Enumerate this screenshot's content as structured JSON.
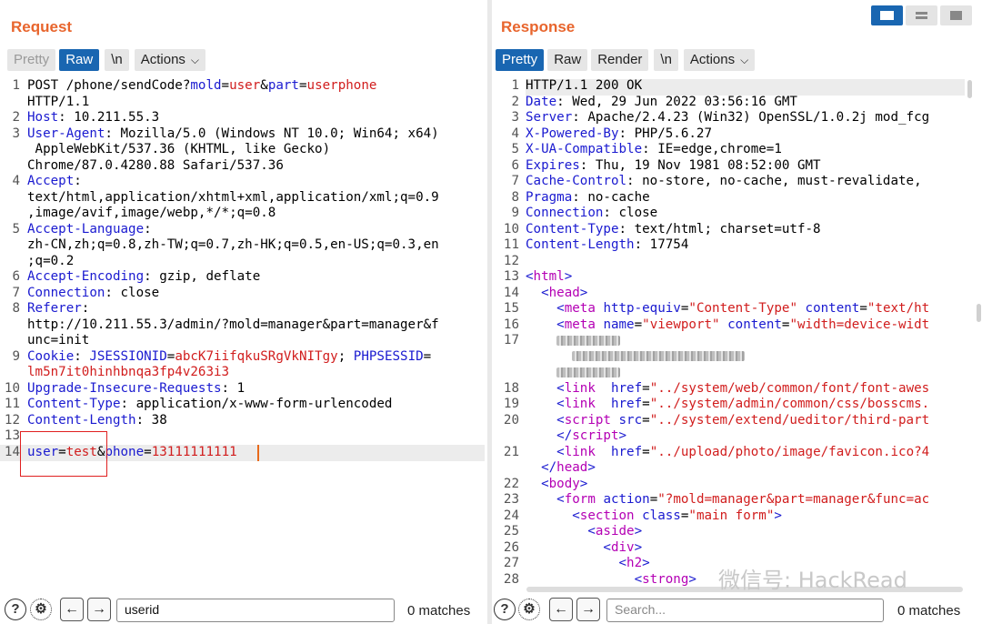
{
  "request": {
    "title": "Request",
    "tabs": [
      "Pretty",
      "Raw",
      "\\n",
      "Actions"
    ],
    "lines": [
      {
        "n": "1",
        "segs": [
          [
            "POST /phone/sendCode?",
            ""
          ],
          [
            "mold",
            "k"
          ],
          [
            "=",
            ""
          ],
          [
            "user",
            "v"
          ],
          [
            "&",
            ""
          ],
          [
            "part",
            "k"
          ],
          [
            "=",
            ""
          ],
          [
            "userphone",
            "v"
          ]
        ]
      },
      {
        "n": "",
        "segs": [
          [
            "HTTP/1.1",
            ""
          ]
        ]
      },
      {
        "n": "2",
        "segs": [
          [
            "Host",
            "k"
          ],
          [
            ": 10.211.55.3",
            ""
          ]
        ]
      },
      {
        "n": "3",
        "segs": [
          [
            "User-Agent",
            "k"
          ],
          [
            ": Mozilla/5.0 (Windows NT 10.0; Win64; x64)",
            ""
          ]
        ]
      },
      {
        "n": "",
        "segs": [
          [
            " AppleWebKit/537.36 (KHTML, like Gecko)",
            ""
          ]
        ]
      },
      {
        "n": "",
        "segs": [
          [
            "Chrome/87.0.4280.88 Safari/537.36",
            ""
          ]
        ]
      },
      {
        "n": "4",
        "segs": [
          [
            "Accept",
            "k"
          ],
          [
            ":",
            ""
          ]
        ]
      },
      {
        "n": "",
        "segs": [
          [
            "text/html,application/xhtml+xml,application/xml;q=0.9",
            ""
          ]
        ]
      },
      {
        "n": "",
        "segs": [
          [
            ",image/avif,image/webp,*/*;q=0.8",
            ""
          ]
        ]
      },
      {
        "n": "5",
        "segs": [
          [
            "Accept-Language",
            "k"
          ],
          [
            ":",
            ""
          ]
        ]
      },
      {
        "n": "",
        "segs": [
          [
            "zh-CN,zh;q=0.8,zh-TW;q=0.7,zh-HK;q=0.5,en-US;q=0.3,en",
            ""
          ]
        ]
      },
      {
        "n": "",
        "segs": [
          [
            ";q=0.2",
            ""
          ]
        ]
      },
      {
        "n": "6",
        "segs": [
          [
            "Accept-Encoding",
            "k"
          ],
          [
            ": gzip, deflate",
            ""
          ]
        ]
      },
      {
        "n": "7",
        "segs": [
          [
            "Connection",
            "k"
          ],
          [
            ": close",
            ""
          ]
        ]
      },
      {
        "n": "8",
        "segs": [
          [
            "Referer",
            "k"
          ],
          [
            ":",
            ""
          ]
        ]
      },
      {
        "n": "",
        "segs": [
          [
            "http://10.211.55.3/admin/?mold=manager&part=manager&f",
            ""
          ]
        ]
      },
      {
        "n": "",
        "segs": [
          [
            "unc=init",
            ""
          ]
        ]
      },
      {
        "n": "9",
        "segs": [
          [
            "Cookie",
            "k"
          ],
          [
            ": ",
            ""
          ],
          [
            "JSESSIONID",
            "k"
          ],
          [
            "=",
            ""
          ],
          [
            "abcK7iifqkuSRgVkNITgy",
            "v"
          ],
          [
            "; ",
            ""
          ],
          [
            "PHPSESSID",
            "k"
          ],
          [
            "=",
            ""
          ]
        ]
      },
      {
        "n": "",
        "segs": [
          [
            "lm5n7it0hinhbnqa3fp4v263i3",
            "v"
          ]
        ]
      },
      {
        "n": "10",
        "segs": [
          [
            "Upgrade-Insecure-Requests",
            "k"
          ],
          [
            ": 1",
            ""
          ]
        ]
      },
      {
        "n": "11",
        "segs": [
          [
            "Content-Type",
            "k"
          ],
          [
            ": application/x-www-form-urlencoded",
            ""
          ]
        ]
      },
      {
        "n": "12",
        "segs": [
          [
            "Content-Length",
            "k"
          ],
          [
            ": 38",
            ""
          ]
        ]
      },
      {
        "n": "13",
        "segs": []
      },
      {
        "n": "14",
        "segs": [
          [
            "user",
            "k"
          ],
          [
            "=",
            ""
          ],
          [
            "test",
            "v"
          ],
          [
            "&",
            ""
          ],
          [
            "phone",
            "k"
          ],
          [
            "=",
            ""
          ],
          [
            "13111111111",
            "v"
          ]
        ]
      }
    ],
    "search_value": "userid",
    "matches": "0 matches"
  },
  "response": {
    "title": "Response",
    "tabs": [
      "Pretty",
      "Raw",
      "Render",
      "\\n",
      "Actions"
    ],
    "lines": [
      {
        "n": "1",
        "segs": [
          [
            "HTTP/1.1 200 OK",
            ""
          ]
        ]
      },
      {
        "n": "2",
        "segs": [
          [
            "Date",
            "k"
          ],
          [
            ": Wed, 29 Jun 2022 03:56:16 GMT",
            ""
          ]
        ]
      },
      {
        "n": "3",
        "segs": [
          [
            "Server",
            "k"
          ],
          [
            ": Apache/2.4.23 (Win32) OpenSSL/1.0.2j mod_fcg",
            ""
          ]
        ]
      },
      {
        "n": "4",
        "segs": [
          [
            "X-Powered-By",
            "k"
          ],
          [
            ": PHP/5.6.27",
            ""
          ]
        ]
      },
      {
        "n": "5",
        "segs": [
          [
            "X-UA-Compatible",
            "k"
          ],
          [
            ": IE=edge,chrome=1",
            ""
          ]
        ]
      },
      {
        "n": "6",
        "segs": [
          [
            "Expires",
            "k"
          ],
          [
            ": Thu, 19 Nov 1981 08:52:00 GMT",
            ""
          ]
        ]
      },
      {
        "n": "7",
        "segs": [
          [
            "Cache-Control",
            "k"
          ],
          [
            ": no-store, no-cache, must-revalidate,",
            ""
          ]
        ]
      },
      {
        "n": "8",
        "segs": [
          [
            "Pragma",
            "k"
          ],
          [
            ": no-cache",
            ""
          ]
        ]
      },
      {
        "n": "9",
        "segs": [
          [
            "Connection",
            "k"
          ],
          [
            ": close",
            ""
          ]
        ]
      },
      {
        "n": "10",
        "segs": [
          [
            "Content-Type",
            "k"
          ],
          [
            ": text/html; charset=utf-8",
            ""
          ]
        ]
      },
      {
        "n": "11",
        "segs": [
          [
            "Content-Length",
            "k"
          ],
          [
            ": 17754",
            ""
          ]
        ]
      },
      {
        "n": "12",
        "segs": []
      },
      {
        "n": "13",
        "segs": [
          [
            "<",
            "at"
          ],
          [
            "html",
            "tg"
          ],
          [
            ">",
            "at"
          ]
        ]
      },
      {
        "n": "14",
        "segs": [
          [
            "  <",
            "at"
          ],
          [
            "head",
            "tg"
          ],
          [
            ">",
            "at"
          ]
        ]
      },
      {
        "n": "15",
        "segs": [
          [
            "    <",
            "at"
          ],
          [
            "meta ",
            "tg"
          ],
          [
            "http-equiv",
            "at"
          ],
          [
            "=",
            ""
          ],
          [
            "\"Content-Type\"",
            "av"
          ],
          [
            " ",
            ""
          ],
          [
            "content",
            "at"
          ],
          [
            "=",
            ""
          ],
          [
            "\"text/ht",
            "av"
          ]
        ]
      },
      {
        "n": "16",
        "segs": [
          [
            "    <",
            "at"
          ],
          [
            "meta ",
            "tg"
          ],
          [
            "name",
            "at"
          ],
          [
            "=",
            ""
          ],
          [
            "\"viewport\"",
            "av"
          ],
          [
            " ",
            ""
          ],
          [
            "content",
            "at"
          ],
          [
            "=",
            ""
          ],
          [
            "\"width=device-widt",
            "av"
          ]
        ]
      },
      {
        "n": "17",
        "segs": [
          [
            "    ",
            "BLUR1"
          ]
        ]
      },
      {
        "n": "",
        "segs": [
          [
            "      ",
            "BLUR2"
          ]
        ]
      },
      {
        "n": "",
        "segs": [
          [
            "    ",
            "BLUR3"
          ]
        ]
      },
      {
        "n": "18",
        "segs": [
          [
            "    <",
            "at"
          ],
          [
            "link ",
            "tg"
          ],
          [
            " href",
            "at"
          ],
          [
            "=",
            ""
          ],
          [
            "\"../system/web/common/font/font-awes",
            "av"
          ]
        ]
      },
      {
        "n": "19",
        "segs": [
          [
            "    <",
            "at"
          ],
          [
            "link ",
            "tg"
          ],
          [
            " href",
            "at"
          ],
          [
            "=",
            ""
          ],
          [
            "\"../system/admin/common/css/bosscms.",
            "av"
          ]
        ]
      },
      {
        "n": "20",
        "segs": [
          [
            "    <",
            "at"
          ],
          [
            "script ",
            "tg"
          ],
          [
            "src",
            "at"
          ],
          [
            "=",
            ""
          ],
          [
            "\"../system/extend/ueditor/third-part",
            "av"
          ]
        ]
      },
      {
        "n": "",
        "segs": [
          [
            "    </",
            "at"
          ],
          [
            "script",
            "tg"
          ],
          [
            ">",
            "at"
          ]
        ]
      },
      {
        "n": "21",
        "segs": [
          [
            "    <",
            "at"
          ],
          [
            "link ",
            "tg"
          ],
          [
            " href",
            "at"
          ],
          [
            "=",
            ""
          ],
          [
            "\"../upload/photo/image/favicon.ico?4",
            "av"
          ]
        ]
      },
      {
        "n": "",
        "segs": [
          [
            "  </",
            "at"
          ],
          [
            "head",
            "tg"
          ],
          [
            ">",
            "at"
          ]
        ]
      },
      {
        "n": "22",
        "segs": [
          [
            "  <",
            "at"
          ],
          [
            "body",
            "tg"
          ],
          [
            ">",
            "at"
          ]
        ]
      },
      {
        "n": "23",
        "segs": [
          [
            "    <",
            "at"
          ],
          [
            "form ",
            "tg"
          ],
          [
            "action",
            "at"
          ],
          [
            "=",
            ""
          ],
          [
            "\"?mold=manager&part=manager&func=ac",
            "av"
          ]
        ]
      },
      {
        "n": "24",
        "segs": [
          [
            "      <",
            "at"
          ],
          [
            "section ",
            "tg"
          ],
          [
            "class",
            "at"
          ],
          [
            "=",
            ""
          ],
          [
            "\"main form\"",
            "av"
          ],
          [
            ">",
            "at"
          ]
        ]
      },
      {
        "n": "25",
        "segs": [
          [
            "        <",
            "at"
          ],
          [
            "aside",
            "tg"
          ],
          [
            ">",
            "at"
          ]
        ]
      },
      {
        "n": "26",
        "segs": [
          [
            "          <",
            "at"
          ],
          [
            "div",
            "tg"
          ],
          [
            ">",
            "at"
          ]
        ]
      },
      {
        "n": "27",
        "segs": [
          [
            "            <",
            "at"
          ],
          [
            "h2",
            "tg"
          ],
          [
            ">",
            "at"
          ]
        ]
      },
      {
        "n": "28",
        "segs": [
          [
            "              <",
            "at"
          ],
          [
            "strong",
            "tg"
          ],
          [
            ">",
            "at"
          ]
        ]
      }
    ],
    "search_placeholder": "Search...",
    "matches": "0 matches"
  },
  "watermark": "微信号: HackRead"
}
